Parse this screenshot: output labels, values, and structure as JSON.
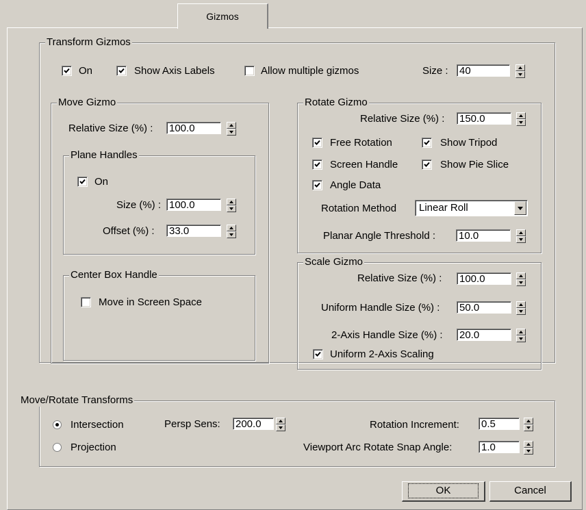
{
  "tab": {
    "label": "Gizmos"
  },
  "transform_gizmos": {
    "title": "Transform Gizmos",
    "on_label": "On",
    "on_checked": true,
    "show_axis_labels_label": "Show Axis Labels",
    "show_axis_labels_checked": true,
    "allow_multiple_label": "Allow multiple gizmos",
    "allow_multiple_checked": false,
    "size_label": "Size :",
    "size_value": "40"
  },
  "move_gizmo": {
    "title": "Move Gizmo",
    "relative_size_label": "Relative Size (%) :",
    "relative_size_value": "100.0",
    "plane_handles": {
      "title": "Plane Handles",
      "on_label": "On",
      "on_checked": true,
      "size_label": "Size (%) :",
      "size_value": "100.0",
      "offset_label": "Offset (%) :",
      "offset_value": "33.0"
    },
    "center_box": {
      "title": "Center Box Handle",
      "screen_space_label": "Move in Screen Space",
      "screen_space_checked": false
    }
  },
  "rotate_gizmo": {
    "title": "Rotate Gizmo",
    "relative_size_label": "Relative Size (%) :",
    "relative_size_value": "150.0",
    "free_rotation_label": "Free Rotation",
    "free_rotation_checked": true,
    "show_tripod_label": "Show Tripod",
    "show_tripod_checked": true,
    "screen_handle_label": "Screen Handle",
    "screen_handle_checked": true,
    "show_pie_slice_label": "Show Pie Slice",
    "show_pie_slice_checked": true,
    "angle_data_label": "Angle Data",
    "angle_data_checked": true,
    "rotation_method_label": "Rotation Method",
    "rotation_method_value": "Linear Roll",
    "planar_threshold_label": "Planar Angle Threshold :",
    "planar_threshold_value": "10.0"
  },
  "scale_gizmo": {
    "title": "Scale Gizmo",
    "relative_size_label": "Relative Size (%) :",
    "relative_size_value": "100.0",
    "uniform_handle_label": "Uniform Handle Size (%) :",
    "uniform_handle_value": "50.0",
    "two_axis_label": "2-Axis Handle Size (%) :",
    "two_axis_value": "20.0",
    "uniform_scaling_label": "Uniform 2-Axis Scaling",
    "uniform_scaling_checked": true
  },
  "move_rotate": {
    "title": "Move/Rotate Transforms",
    "intersection_label": "Intersection",
    "intersection_selected": true,
    "projection_label": "Projection",
    "projection_selected": false,
    "persp_sens_label": "Persp Sens:",
    "persp_sens_value": "200.0",
    "rotation_increment_label": "Rotation Increment:",
    "rotation_increment_value": "0.5",
    "arc_snap_label": "Viewport Arc Rotate Snap Angle:",
    "arc_snap_value": "1.0"
  },
  "buttons": {
    "ok": "OK",
    "cancel": "Cancel"
  }
}
